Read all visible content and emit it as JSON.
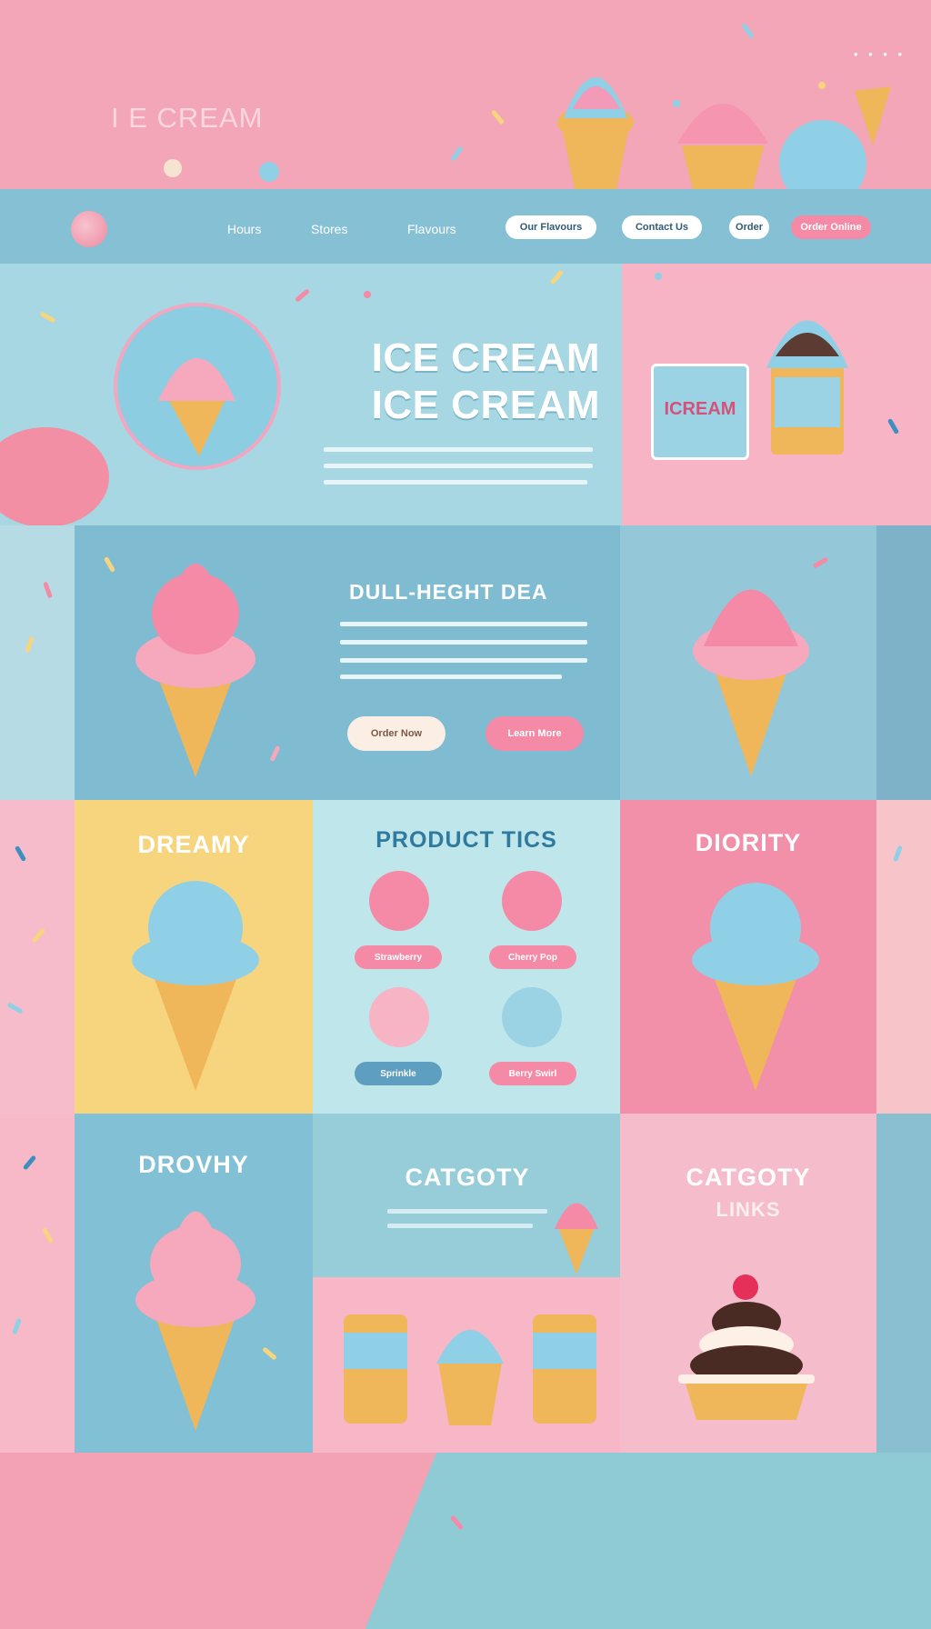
{
  "hero": {
    "brand_word": "I E CREAM",
    "top_dots": "• • • •"
  },
  "nav": {
    "links": [
      "Hours",
      "Stores",
      "Flavours"
    ],
    "buttons": [
      "Our Flavours",
      "Contact Us",
      "Order",
      "Order Online"
    ]
  },
  "feature": {
    "title_line1": "ICE CREAM",
    "title_line2": "ICE CREAM",
    "badge_text": "ICREAM"
  },
  "promo": {
    "title": "DULL-HEGHT DEA",
    "button_primary": "Order Now",
    "button_secondary": "Learn More"
  },
  "products": {
    "dreamy_title": "DREAMY",
    "products_title": "PRODUCT TICS",
    "priority_title": "DIORITY",
    "tags": [
      "Strawberry",
      "Cherry Pop",
      "Sprinkle",
      "Berry Swirl"
    ]
  },
  "categories": {
    "dropy_title": "DROVHY",
    "category_title": "CATGOTY",
    "links_title": "CATGOTY",
    "links_subtitle": "LINKS"
  },
  "colors": {
    "pink": "#f3a6b7",
    "blue": "#86c0d4",
    "yellow": "#f7d47e",
    "cone": "#f0b65a"
  }
}
